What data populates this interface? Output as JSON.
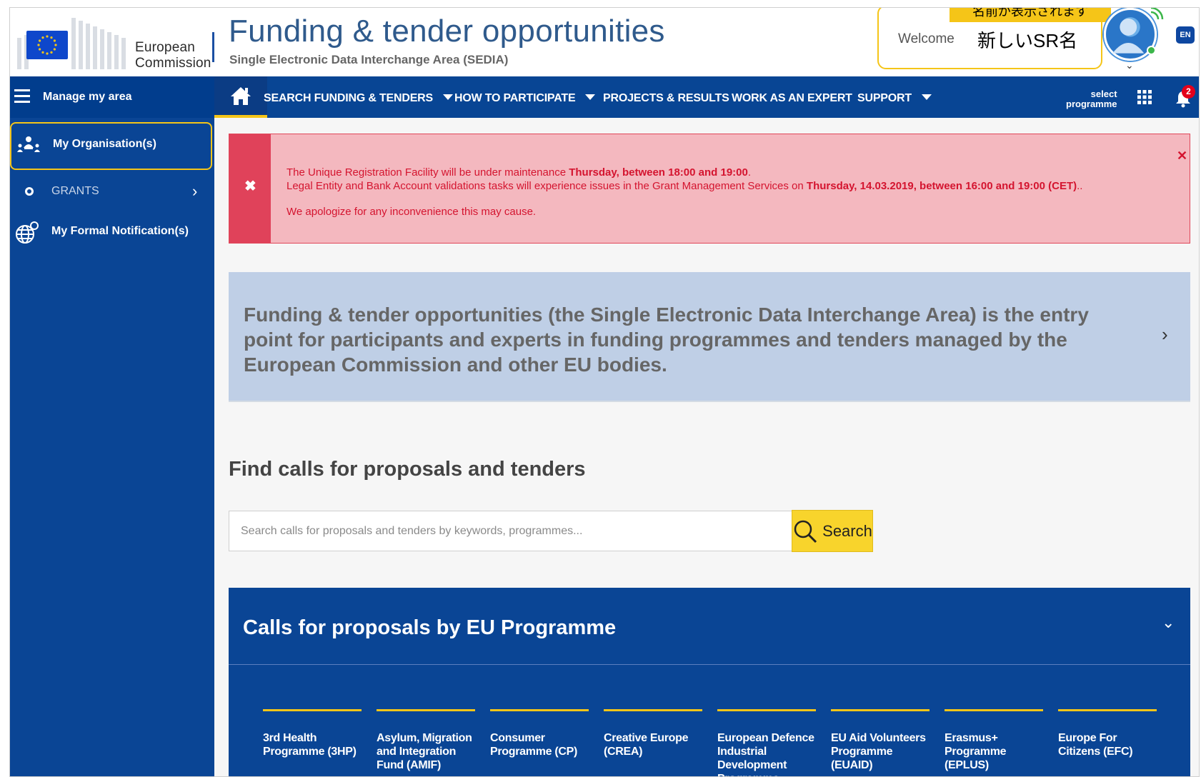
{
  "header": {
    "logo_line1": "European",
    "logo_line2": "Commission",
    "title": "Funding & tender opportunities",
    "subtitle": "Single Electronic Data Interchange Area (SEDIA)",
    "welcome_label": "Welcome",
    "user_name": "新しいSR名",
    "callout": "名前が表示されます",
    "language": "EN"
  },
  "nav": {
    "manage_label": "Manage my area",
    "items": [
      {
        "label": "SEARCH FUNDING & TENDERS",
        "has_dropdown": true
      },
      {
        "label": "HOW TO PARTICIPATE",
        "has_dropdown": true
      },
      {
        "label": "PROJECTS & RESULTS",
        "has_dropdown": false
      },
      {
        "label": "WORK AS AN EXPERT",
        "has_dropdown": false
      },
      {
        "label": "SUPPORT",
        "has_dropdown": true
      }
    ],
    "select_line1": "select",
    "select_line2": "programme",
    "notification_count": "2"
  },
  "sidebar": {
    "items": [
      {
        "label": "My Organisation(s)",
        "icon": "organisation-icon"
      },
      {
        "label": "GRANTS",
        "icon": "circle-icon"
      },
      {
        "label": "My Formal Notification(s)",
        "icon": "globe-notification-icon"
      }
    ]
  },
  "alert": {
    "line1_pre": "The Unique Registration Facility will be under maintenance ",
    "line1_bold": "Thursday, between 18:00 and 19:00",
    "line1_post": ".",
    "line2_pre": "Legal Entity and Bank Account validations tasks will experience issues in the Grant Management Services on ",
    "line2_bold": "Thursday, 14.03.2019, between 16:00 and 19:00 (CET)",
    "line2_post": "..",
    "line3": "We apologize for any inconvenience this may cause."
  },
  "intro": {
    "text": "Funding & tender opportunities (the Single Electronic Data Interchange Area) is the entry point for participants and experts in funding programmes and tenders managed by the European Commission and other EU bodies."
  },
  "search": {
    "title": "Find calls for proposals and tenders",
    "placeholder": "Search calls for proposals and tenders by keywords, programmes...",
    "button_label": "Search"
  },
  "calls": {
    "title": "Calls for proposals by EU Programme",
    "programmes": [
      "3rd Health Programme (3HP)",
      "Asylum, Migration and Integration Fund (AMIF)",
      "Consumer Programme (CP)",
      "Creative Europe (CREA)",
      "European Defence Industrial Development Programme",
      "EU Aid Volunteers Programme (EUAID)",
      "Erasmus+ Programme (EPLUS)",
      "Europe For Citizens (EFC)"
    ]
  },
  "colors": {
    "nav_blue": "#084594",
    "sidebar_blue": "#0a4595",
    "accent_yellow": "#f5c518",
    "alert_red": "#e0425a",
    "alert_bg": "#f4b8bf"
  }
}
